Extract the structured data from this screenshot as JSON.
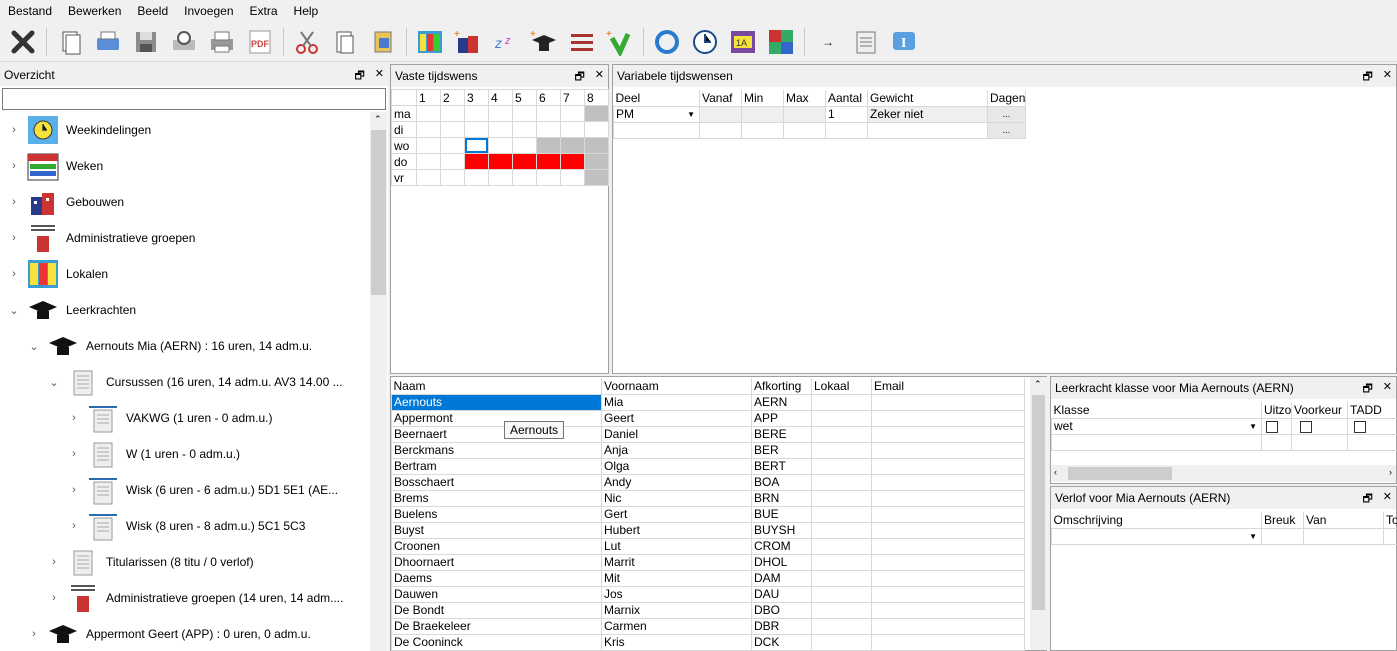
{
  "menu": [
    "Bestand",
    "Bewerken",
    "Beeld",
    "Invoegen",
    "Extra",
    "Help"
  ],
  "toolbar_icons": [
    "delete-icon",
    "copy-icon",
    "print-preview-icon",
    "save-icon",
    "search-print-icon",
    "printer-icon",
    "pdf-icon",
    "cut-icon",
    "paste-icon",
    "paste-special-icon",
    "timetable-icon",
    "buildings-add-icon",
    "zz-icon",
    "teacher-add-icon",
    "groups-icon",
    "check-add-icon",
    "refresh-icon",
    "clock-icon",
    "class-1a-icon",
    "mosaic-icon",
    "arrow-icon",
    "notepad-icon",
    "info-icon"
  ],
  "overview": {
    "title": "Overzicht",
    "search_value": "",
    "items": [
      {
        "label": "Weekindelingen",
        "icon": "clock-grid-icon",
        "chev": "›"
      },
      {
        "label": "Weken",
        "icon": "calendar-icon",
        "chev": "›"
      },
      {
        "label": "Gebouwen",
        "icon": "buildings-icon",
        "chev": "›"
      },
      {
        "label": "Administratieve groepen",
        "icon": "admin-group-icon",
        "chev": "›"
      },
      {
        "label": "Lokalen",
        "icon": "rooms-icon",
        "chev": "›"
      },
      {
        "label": "Leerkrachten",
        "icon": "teacher-hat-icon",
        "chev": "⌄"
      },
      {
        "label": "Aernouts Mia (AERN) : 16 uren, 14 adm.u.",
        "icon": "teacher-hat-icon",
        "chev": "⌄"
      },
      {
        "label": "Cursussen (16 uren, 14 adm.u.  AV3 14.00 ...",
        "icon": "book-icon",
        "chev": "⌄"
      },
      {
        "label": "VAKWG (1 uren - 0 adm.u.)",
        "icon": "book-arrow-icon",
        "chev": "›"
      },
      {
        "label": "W (1 uren - 0 adm.u.)",
        "icon": "book-icon",
        "chev": "›"
      },
      {
        "label": "Wisk (6 uren - 6 adm.u.)  5D1 5E1  (AE...",
        "icon": "book-arrow-icon",
        "chev": "›"
      },
      {
        "label": "Wisk (8 uren - 8 adm.u.)  5C1 5C3",
        "icon": "book-arrow-icon",
        "chev": "›"
      },
      {
        "label": "Titularissen (8 titu / 0 verlof)",
        "icon": "book-icon",
        "chev": "›"
      },
      {
        "label": "Administratieve groepen (14 uren, 14 adm....",
        "icon": "admin-group-icon",
        "chev": "›"
      },
      {
        "label": "Appermont Geert (APP) : 0 uren, 0 adm.u.",
        "icon": "teacher-hat-icon",
        "chev": "›"
      }
    ]
  },
  "fixed": {
    "title": "Vaste tijdswens",
    "periods": [
      "1",
      "2",
      "3",
      "4",
      "5",
      "6",
      "7",
      "8"
    ],
    "days": [
      {
        "day": "ma",
        "cells": [
          "",
          "",
          "",
          "",
          "",
          "",
          "",
          "g"
        ]
      },
      {
        "day": "di",
        "cells": [
          "",
          "",
          "",
          "",
          "",
          "",
          "",
          ""
        ]
      },
      {
        "day": "wo",
        "cells": [
          "",
          "",
          "s",
          "",
          "",
          "g",
          "g",
          "g"
        ]
      },
      {
        "day": "do",
        "cells": [
          "",
          "",
          "r",
          "r",
          "r",
          "r",
          "r",
          "g"
        ]
      },
      {
        "day": "vr",
        "cells": [
          "",
          "",
          "",
          "",
          "",
          "",
          "",
          "g"
        ]
      }
    ]
  },
  "variable": {
    "title": "Variabele tijdswensen",
    "headers": [
      "Deel",
      "Vanaf",
      "Min",
      "Max",
      "Aantal",
      "Gewicht",
      "Dagen"
    ],
    "rows": [
      {
        "deel": "PM",
        "vanaf": "",
        "min": "",
        "max": "",
        "aantal": "1",
        "gewicht": "Zeker niet",
        "dagen": "..."
      },
      {
        "deel": "",
        "vanaf": "",
        "min": "",
        "max": "",
        "aantal": "",
        "gewicht": "",
        "dagen": "..."
      }
    ]
  },
  "teachers": {
    "headers": [
      "Naam",
      "Voornaam",
      "Afkorting",
      "Lokaal",
      "Email"
    ],
    "tooltip": "Aernouts",
    "rows": [
      [
        "Aernouts",
        "Mia",
        "AERN"
      ],
      [
        "Appermont",
        "Geert",
        "APP"
      ],
      [
        "Beernaert",
        "Daniel",
        "BERE"
      ],
      [
        "Berckmans",
        "Anja",
        "BER"
      ],
      [
        "Bertram",
        "Olga",
        "BERT"
      ],
      [
        "Bosschaert",
        "Andy",
        "BOA"
      ],
      [
        "Brems",
        "Nic",
        "BRN"
      ],
      [
        "Buelens",
        "Gert",
        "BUE"
      ],
      [
        "Buyst",
        "Hubert",
        "BUYSH"
      ],
      [
        "Croonen",
        "Lut",
        "CROM"
      ],
      [
        "Dhoornaert",
        "Marrit",
        "DHOL"
      ],
      [
        "Daems",
        "Mit",
        "DAM"
      ],
      [
        "Dauwen",
        "Jos",
        "DAU"
      ],
      [
        "De Bondt",
        "Marnix",
        "DBO"
      ],
      [
        "De Braekeleer",
        "Carmen",
        "DBR"
      ],
      [
        "De Cooninck",
        "Kris",
        "DCK"
      ]
    ]
  },
  "klasse": {
    "title": "Leerkracht klasse voor Mia Aernouts (AERN)",
    "headers": [
      "Klasse",
      "Uitzo",
      "Voorkeur",
      "TADD"
    ],
    "row_value": "wet"
  },
  "verlof": {
    "title": "Verlof voor Mia Aernouts (AERN)",
    "headers": [
      "Omschrijving",
      "Breuk",
      "Van",
      "To"
    ]
  },
  "colors": {
    "accent_select": "#0078d7",
    "red": "#ff0000"
  }
}
